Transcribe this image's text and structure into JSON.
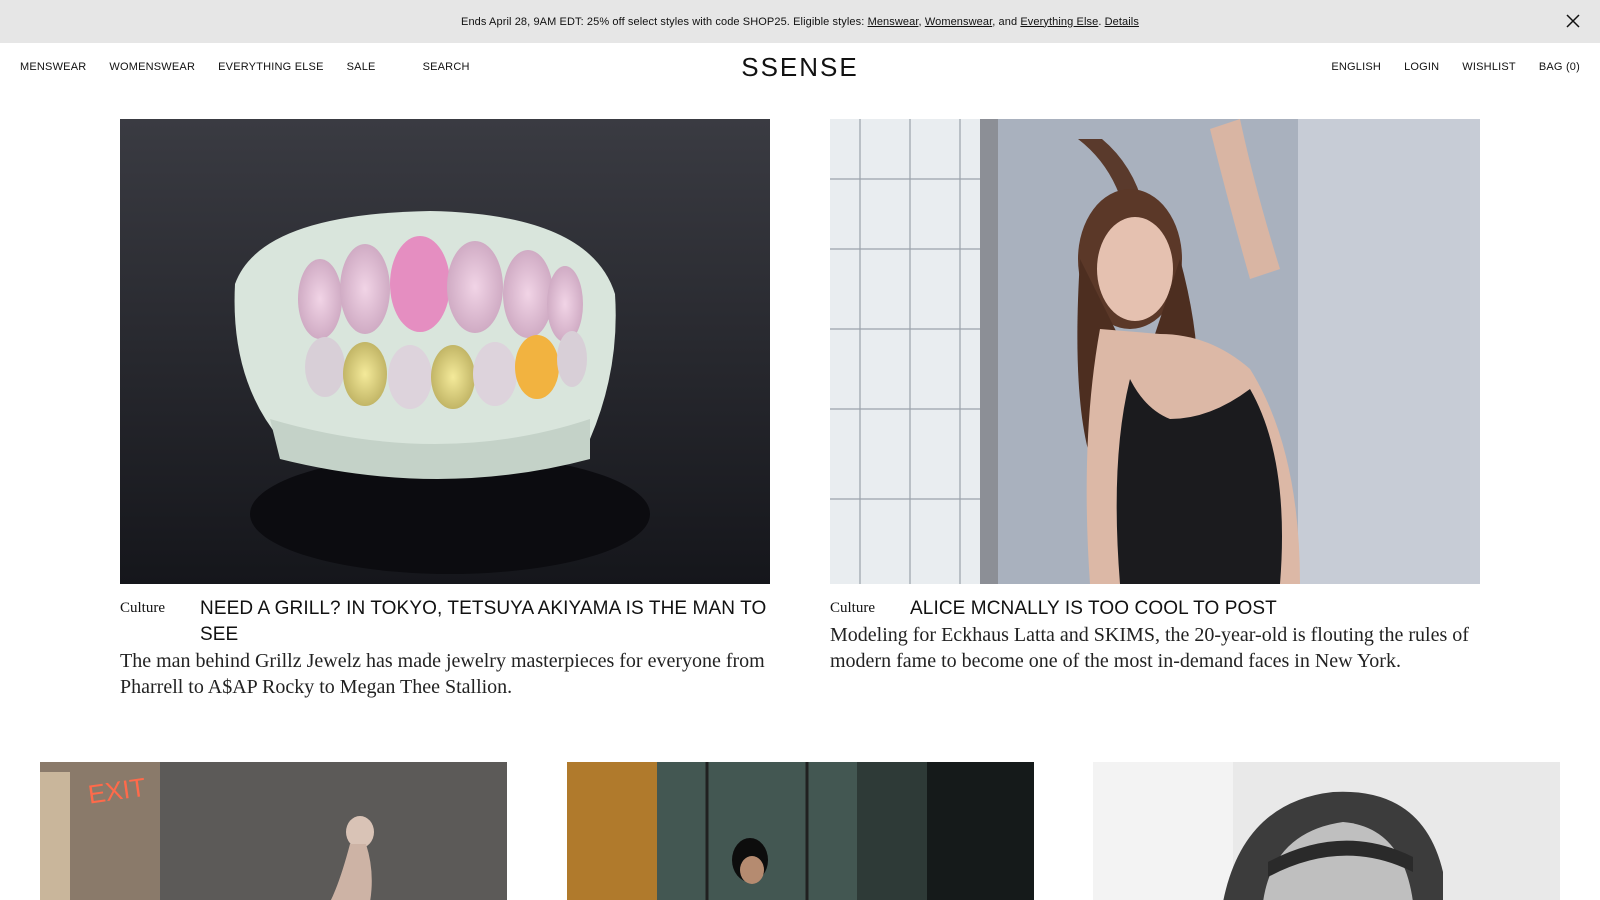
{
  "banner": {
    "text_prefix": "Ends April 28, 9AM EDT: 25% off select styles with code SHOP25. Eligible styles: ",
    "link_menswear": "Menswear",
    "sep1": ", ",
    "link_womenswear": "Womenswear",
    "sep2": ", and ",
    "link_everything": "Everything Else",
    "sep3": ". ",
    "link_details": "Details",
    "close_icon": "close-icon"
  },
  "nav": {
    "left": [
      "MENSWEAR",
      "WOMENSWEAR",
      "EVERYTHING ELSE",
      "SALE",
      "SEARCH"
    ],
    "logo": "SSENSE",
    "right": [
      "ENGLISH",
      "LOGIN",
      "WISHLIST",
      "BAG (0)"
    ]
  },
  "features": [
    {
      "category": "Culture",
      "title": "NEED A GRILL? IN TOKYO, TETSUYA AKIYAMA IS THE MAN TO SEE",
      "description": "The man behind Grillz Jewelz has made jewelry masterpieces for everyone from Pharrell to A$AP Rocky to Megan Thee Stallion."
    },
    {
      "category": "Culture",
      "title": "ALICE MCNALLY IS TOO COOL TO POST",
      "description": "Modeling for Eckhaus Latta and SKIMS, the 20-year-old is flouting the rules of modern fame to become one of the most in-demand faces in New York."
    }
  ],
  "thumbs": {
    "exit_sign": "EXIT"
  }
}
